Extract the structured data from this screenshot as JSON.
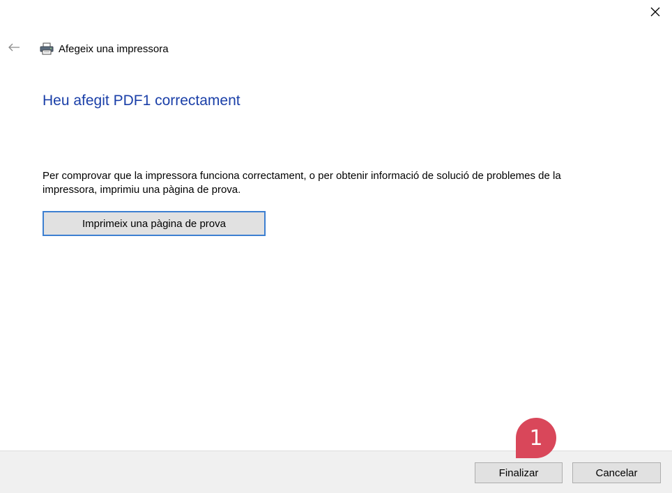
{
  "window": {
    "close_icon": "close-icon",
    "back_icon": "back-arrow-icon",
    "printer_icon": "printer-icon",
    "title": "Afegeix una impressora"
  },
  "main": {
    "heading": "Heu afegit PDF1 correctament",
    "description": "Per comprovar que la impressora funciona correctament, o per obtenir informació de solució de problemes de la impressora, imprimiu una pàgina de prova.",
    "test_page_button": "Imprimeix una pàgina de prova"
  },
  "footer": {
    "finish_button": "Finalizar",
    "cancel_button": "Cancelar"
  },
  "annotation": {
    "step_number": "1"
  },
  "colors": {
    "heading": "#1a3fa8",
    "focus_border": "#3c7fd1",
    "badge": "#d9475a",
    "footer_bg": "#f0f0f0"
  }
}
